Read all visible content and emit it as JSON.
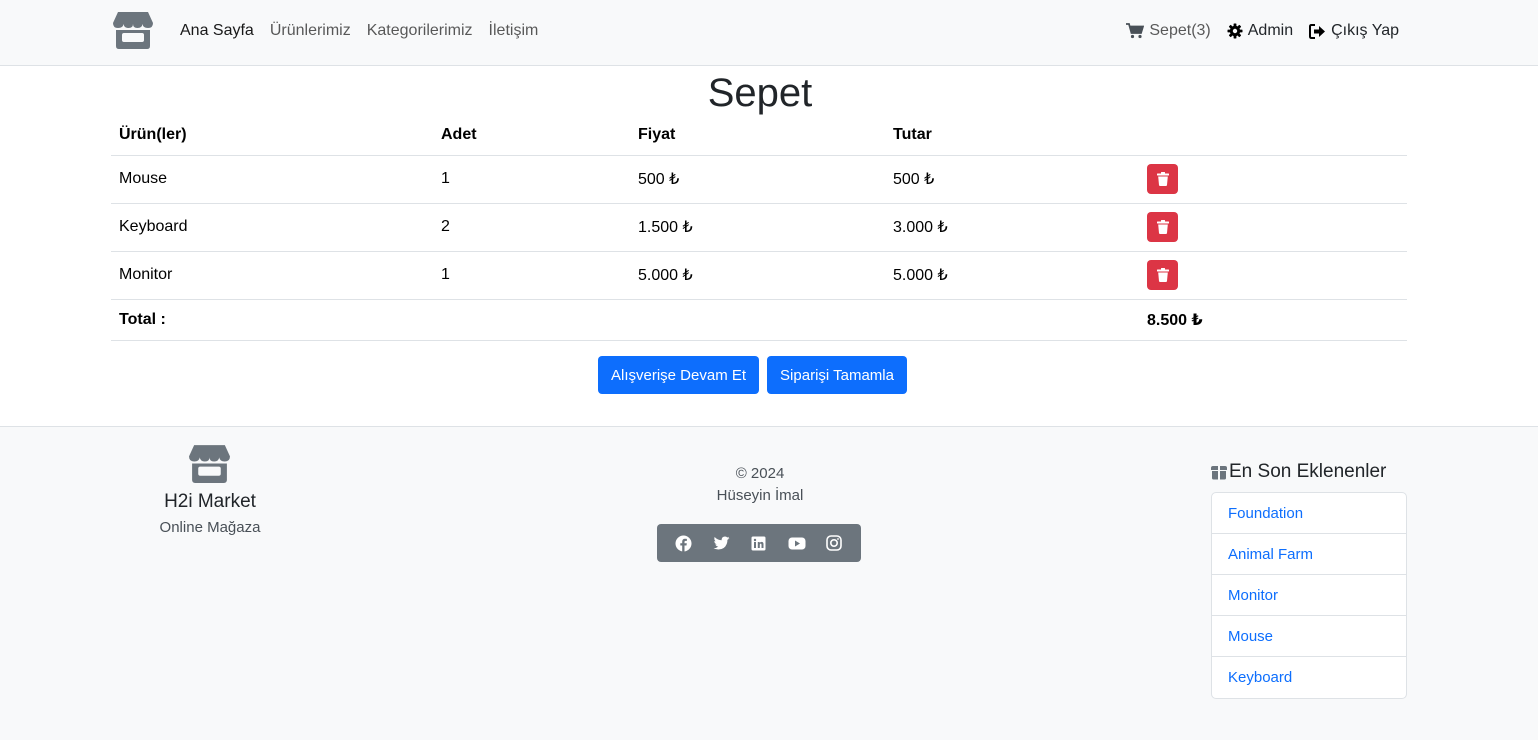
{
  "nav": {
    "links": [
      "Ana Sayfa",
      "Ürünlerimiz",
      "Kategorilerimiz",
      "İletişim"
    ],
    "cart_label": "Sepet(3)",
    "admin_label": "Admin",
    "logout_label": "Çıkış Yap"
  },
  "page": {
    "title": "Sepet"
  },
  "table": {
    "headers": [
      "Ürün(ler)",
      "Adet",
      "Fiyat",
      "Tutar"
    ],
    "rows": [
      {
        "product": "Mouse",
        "qty": "1",
        "price": "500 ₺",
        "total": "500 ₺"
      },
      {
        "product": "Keyboard",
        "qty": "2",
        "price": "1.500 ₺",
        "total": "3.000 ₺"
      },
      {
        "product": "Monitor",
        "qty": "1",
        "price": "5.000 ₺",
        "total": "5.000 ₺"
      }
    ],
    "total_label": "Total :",
    "total_value": "8.500 ₺"
  },
  "actions": {
    "continue_label": "Alışverişe Devam Et",
    "complete_label": "Siparişi Tamamla"
  },
  "footer": {
    "brand": "H2i Market",
    "subtitle": "Online Mağaza",
    "copyright": "© 2024",
    "author": "Hüseyin İmal",
    "social_icons": [
      "facebook-icon",
      "twitter-icon",
      "linkedin-icon",
      "youtube-icon",
      "instagram-icon"
    ],
    "latest_title": "En Son Eklenenler",
    "latest_items": [
      "Foundation",
      "Animal Farm",
      "Monitor",
      "Mouse",
      "Keyboard"
    ]
  },
  "colors": {
    "primary": "#0d6efd",
    "danger": "#dc3545",
    "secondary": "#6c757d",
    "light": "#f8f9fa"
  }
}
